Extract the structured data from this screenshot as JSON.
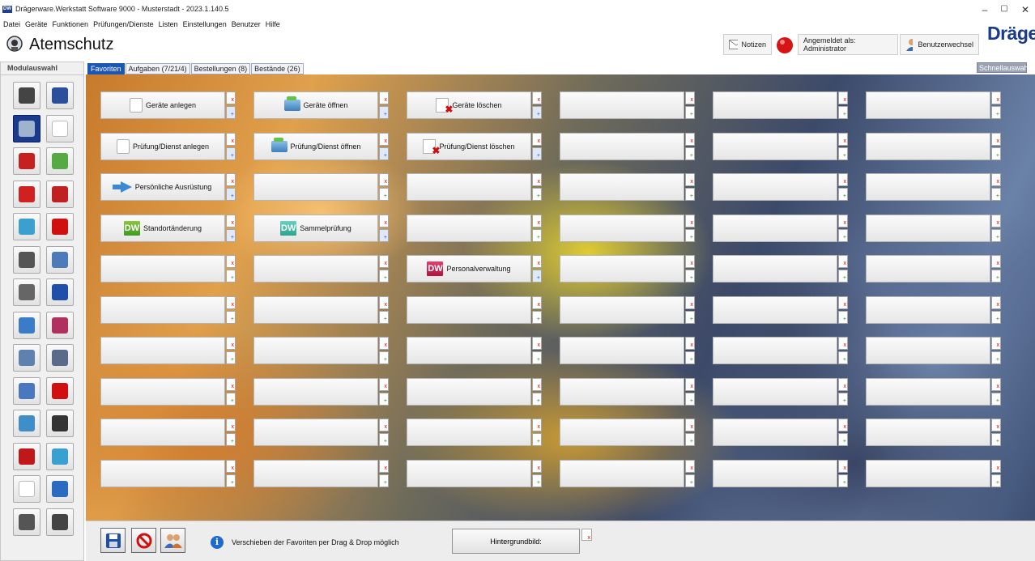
{
  "window": {
    "title": "Drägerware.Werkstatt Software 9000 - Musterstadt - 2023.1.140.5",
    "app_icon": "DW",
    "controls": [
      "–",
      "▢",
      "✕"
    ]
  },
  "menu": [
    "Datei",
    "Geräte",
    "Funktionen",
    "Prüfungen/Dienste",
    "Listen",
    "Einstellungen",
    "Benutzer",
    "Hilfe"
  ],
  "header": {
    "module_title": "Atemschutz",
    "notes_label": "Notizen",
    "logged_in_label": "Angemeldet als: Administrator",
    "switch_user_label": "Benutzerwechsel",
    "brand": "Dräger"
  },
  "sidebar": {
    "title": "Modulauswahl",
    "modules": [
      {
        "name": "laptop-icon",
        "color": "#444"
      },
      {
        "name": "harness-icon",
        "color": "#2b4f9a"
      },
      {
        "name": "mask-icon",
        "color": "#9fb3cf",
        "active": true
      },
      {
        "name": "blank-icon",
        "color": "#fff"
      },
      {
        "name": "ladder-icon",
        "color": "#c62020"
      },
      {
        "name": "gauge-icon",
        "color": "#55aa44"
      },
      {
        "name": "fire-truck-icon",
        "color": "#d02020"
      },
      {
        "name": "extinguisher-icon",
        "color": "#c02020"
      },
      {
        "name": "house-icon",
        "color": "#3aa0d0"
      },
      {
        "name": "hydrant-icon",
        "color": "#d01010"
      },
      {
        "name": "tool-icon",
        "color": "#555"
      },
      {
        "name": "rope-icon",
        "color": "#4d7ab8"
      },
      {
        "name": "syringe-icon",
        "color": "#666"
      },
      {
        "name": "warning-triangle-icon",
        "color": "#1f4fa8"
      },
      {
        "name": "radio-icon",
        "color": "#3a7cc8"
      },
      {
        "name": "cabinet-icon",
        "color": "#b03060"
      },
      {
        "name": "building-icon",
        "color": "#6080b0"
      },
      {
        "name": "id-card-icon",
        "color": "#5a6a8a"
      },
      {
        "name": "pump-icon",
        "color": "#4a78c0"
      },
      {
        "name": "first-aid-icon",
        "color": "#d01010"
      },
      {
        "name": "gas-detector-icon",
        "color": "#3e8ec9"
      },
      {
        "name": "camera-icon",
        "color": "#333"
      },
      {
        "name": "hose-reel-icon",
        "color": "#c01818"
      },
      {
        "name": "hose-icon",
        "color": "#3aa0d0"
      },
      {
        "name": "blank-module-icon",
        "color": "#fff"
      },
      {
        "name": "valve-icon",
        "color": "#2a6ac0"
      },
      {
        "name": "boot-icon",
        "color": "#555"
      },
      {
        "name": "glove-boot-icon",
        "color": "#444"
      }
    ]
  },
  "tabs": [
    {
      "label": "Favoriten",
      "active": true
    },
    {
      "label": "Aufgaben (7/21/4)"
    },
    {
      "label": "Bestellungen (8)"
    },
    {
      "label": "Bestände (26)"
    }
  ],
  "quick_select": "Schnellauswahl",
  "favorites": [
    [
      {
        "label": "Geräte anlegen",
        "icon": "box"
      },
      {
        "label": "Geräte öffnen",
        "icon": "folder"
      },
      {
        "label": "Geräte löschen",
        "icon": "delete"
      },
      {
        "label": ""
      },
      {
        "label": ""
      },
      {
        "label": ""
      }
    ],
    [
      {
        "label": "Prüfung/Dienst anlegen",
        "icon": "box"
      },
      {
        "label": "Prüfung/Dienst öffnen",
        "icon": "folder"
      },
      {
        "label": "Prüfung/Dienst löschen",
        "icon": "delete"
      },
      {
        "label": ""
      },
      {
        "label": ""
      },
      {
        "label": ""
      }
    ],
    [
      {
        "label": "Persönliche Ausrüstung",
        "icon": "arrow"
      },
      {
        "label": ""
      },
      {
        "label": ""
      },
      {
        "label": ""
      },
      {
        "label": ""
      },
      {
        "label": ""
      }
    ],
    [
      {
        "label": "Standortänderung",
        "icon": "dw-green"
      },
      {
        "label": "Sammelprüfung",
        "icon": "dw-teal"
      },
      {
        "label": ""
      },
      {
        "label": ""
      },
      {
        "label": ""
      },
      {
        "label": ""
      }
    ],
    [
      {
        "label": ""
      },
      {
        "label": ""
      },
      {
        "label": "Personalverwaltung",
        "icon": "dw-red"
      },
      {
        "label": ""
      },
      {
        "label": ""
      },
      {
        "label": ""
      }
    ],
    [
      {
        "label": ""
      },
      {
        "label": ""
      },
      {
        "label": ""
      },
      {
        "label": ""
      },
      {
        "label": ""
      },
      {
        "label": ""
      }
    ],
    [
      {
        "label": ""
      },
      {
        "label": ""
      },
      {
        "label": ""
      },
      {
        "label": ""
      },
      {
        "label": ""
      },
      {
        "label": ""
      }
    ],
    [
      {
        "label": ""
      },
      {
        "label": ""
      },
      {
        "label": ""
      },
      {
        "label": ""
      },
      {
        "label": ""
      },
      {
        "label": ""
      }
    ],
    [
      {
        "label": ""
      },
      {
        "label": ""
      },
      {
        "label": ""
      },
      {
        "label": ""
      },
      {
        "label": ""
      },
      {
        "label": ""
      }
    ],
    [
      {
        "label": ""
      },
      {
        "label": ""
      },
      {
        "label": ""
      },
      {
        "label": ""
      },
      {
        "label": ""
      },
      {
        "label": ""
      }
    ]
  ],
  "icon_text": {
    "dw": "DW",
    "delete_mark": "✖",
    "remove_mark": "x",
    "add_mark": "+"
  },
  "bottom": {
    "hint": "Verschieben der Favoriten per Drag & Drop möglich",
    "background_label": "Hintergrundbild:",
    "info_glyph": "i"
  }
}
